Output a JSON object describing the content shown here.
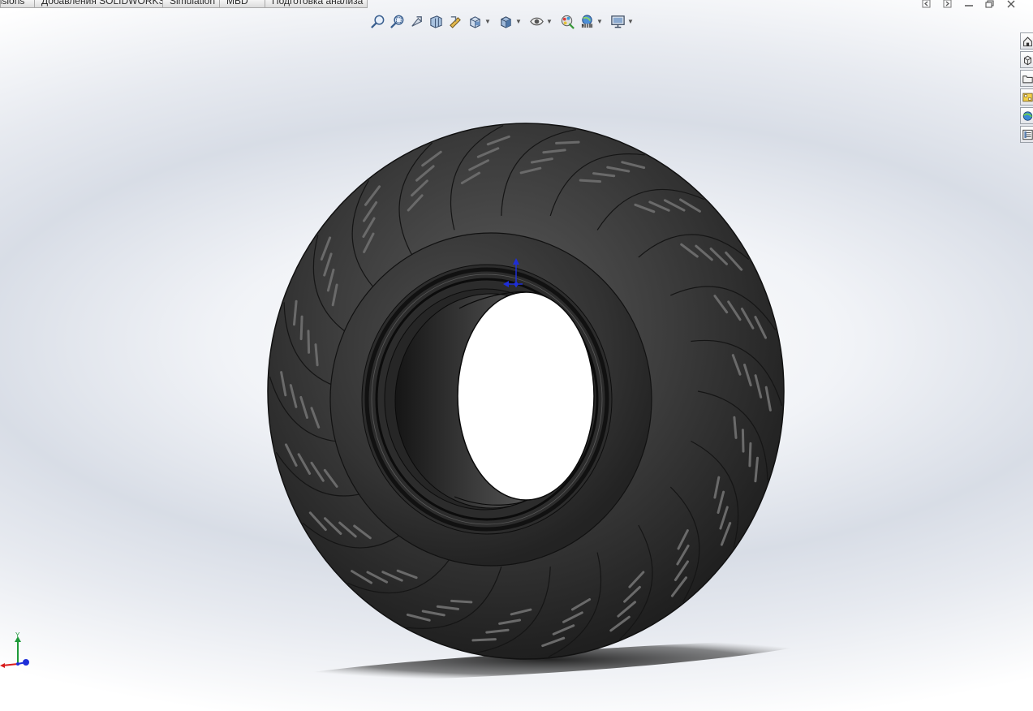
{
  "command_tabs": [
    "ensions",
    "Добавления SOLIDWORKS",
    "Simulation",
    "MBD",
    "Подготовка анализа"
  ],
  "heads_up_toolbar": [
    {
      "icon": "zoom-to-fit-icon",
      "has_dropdown": false
    },
    {
      "icon": "zoom-to-area-icon",
      "has_dropdown": false
    },
    {
      "icon": "previous-view-icon",
      "has_dropdown": false
    },
    {
      "icon": "section-view-icon",
      "has_dropdown": false
    },
    {
      "icon": "dynamic-annotation-icon",
      "has_dropdown": false
    },
    {
      "icon": "view-orientation-icon",
      "has_dropdown": true
    },
    {
      "icon": "display-style-icon",
      "has_dropdown": true
    },
    {
      "icon": "hide-show-items-icon",
      "has_dropdown": true
    },
    {
      "icon": "edit-appearance-icon",
      "has_dropdown": false
    },
    {
      "icon": "apply-scene-icon",
      "has_dropdown": true
    },
    {
      "icon": "view-settings-icon",
      "has_dropdown": true
    }
  ],
  "window_controls": [
    "prev-window-icon",
    "next-window-icon",
    "minimize-icon",
    "restore-icon",
    "close-icon"
  ],
  "task_pane": [
    "solidworks-resources-icon",
    "design-library-icon",
    "file-explorer-icon",
    "view-palette-icon",
    "appearances-scenes-icon",
    "custom-properties-icon"
  ],
  "triad": {
    "y_label": "Y"
  },
  "colors": {
    "tire": "#3a3a3a",
    "tire_dark": "#1e1e1e",
    "axis_x": "#d81e1e",
    "axis_y": "#1e9a3a",
    "axis_z": "#1e2ed8"
  }
}
